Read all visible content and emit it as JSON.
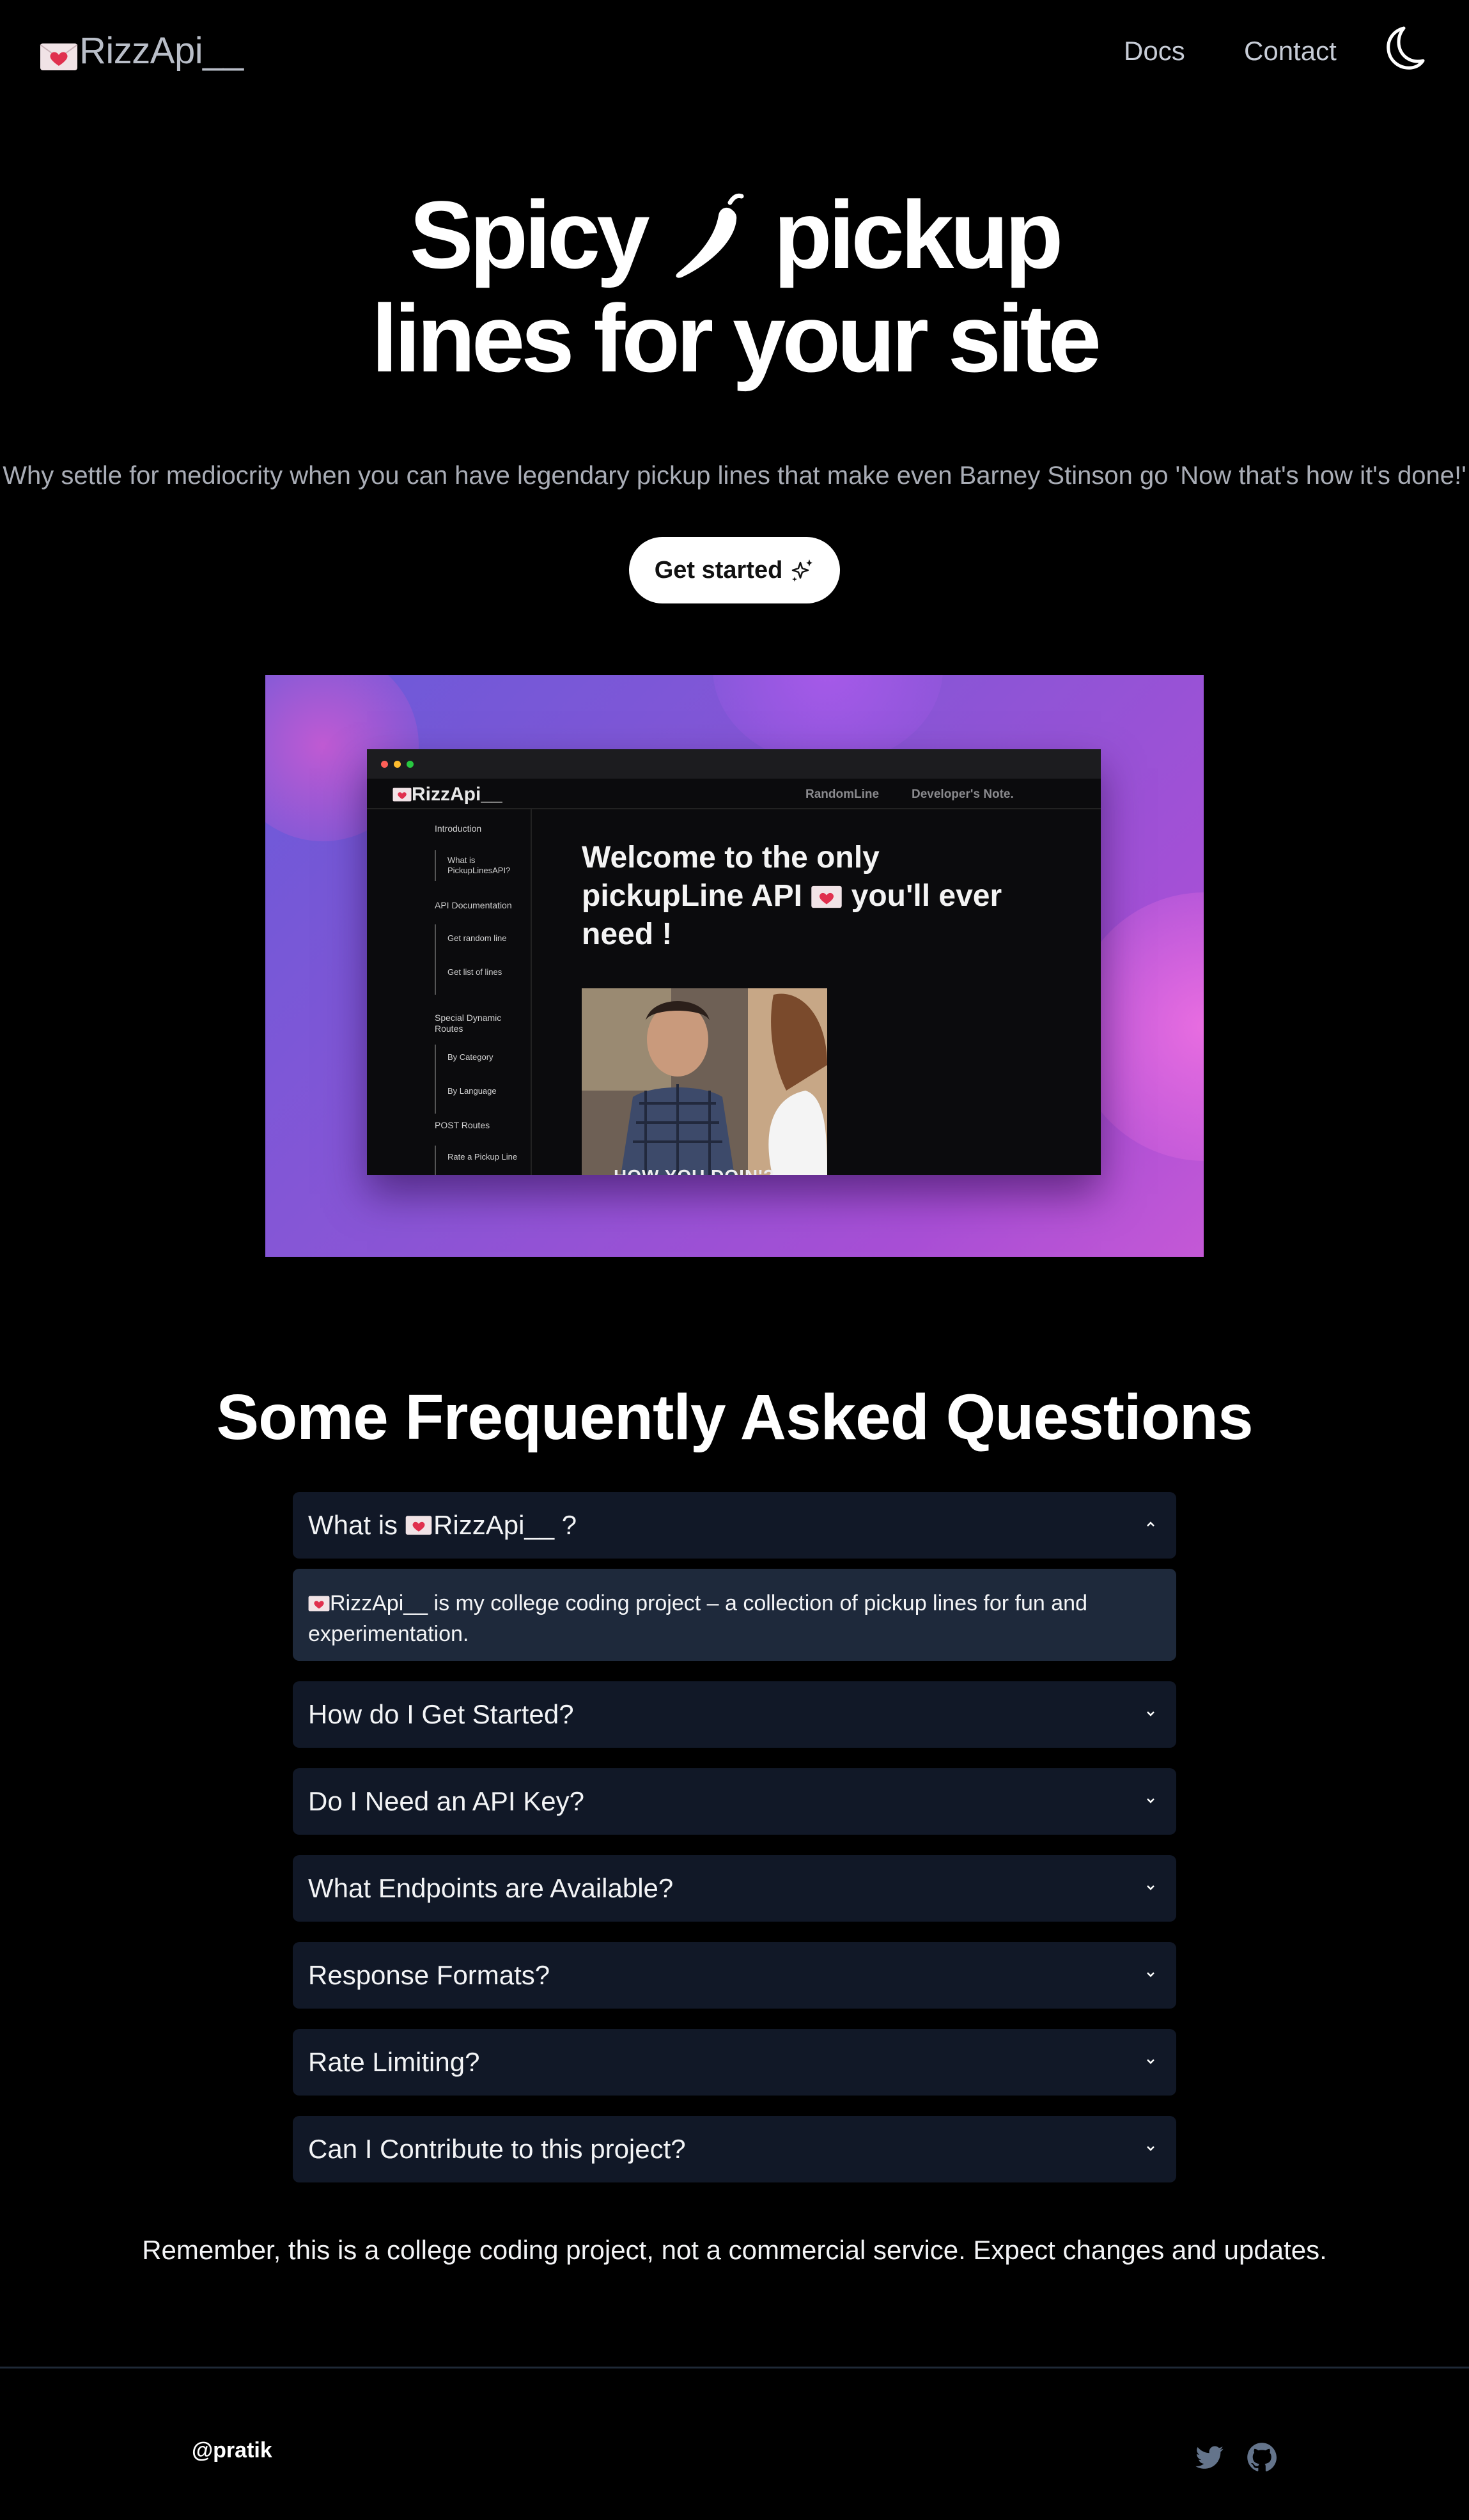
{
  "nav": {
    "logo": "RizzApi__",
    "docs": "Docs",
    "contact": "Contact",
    "theme_icon": "moon-icon"
  },
  "hero": {
    "title_line1_a": "Spicy",
    "title_line1_b": "pickup",
    "title_line2": "lines for your site",
    "subtitle": "Why settle for mediocrity when you can have legendary pickup lines that make even Barney Stinson go 'Now that's how it's done!'",
    "cta": "Get started"
  },
  "preview": {
    "logo": "RizzApi__",
    "nav_links": [
      "RandomLine",
      "Developer's Note."
    ],
    "sidebar": {
      "intro": "Introduction",
      "what_is": "What is PickupLinesAPI?",
      "api_doc": "API Documentation",
      "random": "Get random line",
      "list": "Get list of lines",
      "dynamic": "Special Dynamic Routes",
      "category": "By Category",
      "language": "By Language",
      "post": "POST Routes",
      "rate": "Rate a Pickup Line"
    },
    "heading_a": "Welcome to the only pickupLine API",
    "heading_b": "you'll ever need !",
    "gif_caption": "HOW YOU DOIN'?"
  },
  "faq": {
    "title": "Some Frequently Asked Questions",
    "q1_a": "What is",
    "q1_b": "RizzApi__ ?",
    "a1_brand": "RizzApi__",
    "a1_rest": " is my college coding project – a collection of pickup lines for fun and experimentation.",
    "q2": "How do I Get Started?",
    "q3": "Do I Need an API Key?",
    "q4": "What Endpoints are Available?",
    "q5": "Response Formats?",
    "q6": "Rate Limiting?",
    "q7": "Can I Contribute to this project?"
  },
  "note": "Remember, this is a college coding project, not a commercial service. Expect changes and updates.",
  "footer": {
    "handle": "@pratik",
    "icons": [
      "twitter-icon",
      "github-icon"
    ]
  },
  "colors": {
    "background": "#000000",
    "faq_bg": "#111827",
    "faq_open_bg": "#1e293b",
    "preview_gradient_start": "#6a5ad8",
    "preview_gradient_end": "#c458d6"
  }
}
